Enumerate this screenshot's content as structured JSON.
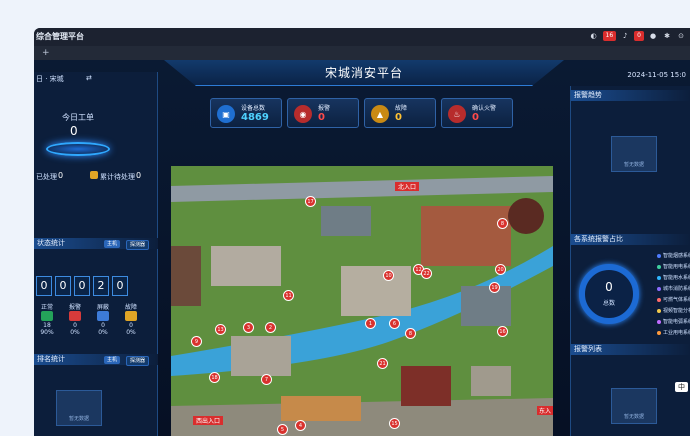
{
  "window": {
    "title": "综合管理平台",
    "alerts_count": "16",
    "notify_count": "0"
  },
  "app": {
    "title": "宋城消安平台",
    "datetime": "2024-11-05 15:0",
    "left": {
      "scope_label": "日 · 宋城",
      "swap_icon": "⇄",
      "today_title": "今日工单",
      "today_value": "0",
      "processed_label": "已处理",
      "processed_value": "0",
      "pending_label": "累计待处理",
      "pending_value": "0",
      "device_stats_title": "状态统计",
      "tab_host": "主机",
      "tab_detector": "探测器",
      "digits": [
        "0",
        "0",
        "0",
        "2",
        "0"
      ],
      "stats": [
        {
          "label": "正常",
          "value": "18",
          "pct": "90%",
          "color": "#24a35a"
        },
        {
          "label": "报警",
          "value": "0",
          "pct": "0%",
          "color": "#d63b3b"
        },
        {
          "label": "屏蔽",
          "value": "0",
          "pct": "0%",
          "color": "#3d7bd8"
        },
        {
          "label": "故障",
          "value": "0",
          "pct": "0%",
          "color": "#e0a526"
        }
      ],
      "rank_title": "排名统计",
      "rank_tab_host": "主机",
      "rank_tab_detector": "探测器",
      "no_data": "暂无数据"
    },
    "kpis": [
      {
        "label": "设备总数",
        "value": "4869",
        "color": "#4fd2ff",
        "icon": "▣",
        "bg": "#1f6fd1"
      },
      {
        "label": "报警",
        "value": "0",
        "color": "#ff4a4a",
        "icon": "◉",
        "bg": "#b72c2c"
      },
      {
        "label": "故障",
        "value": "0",
        "color": "#ffc233",
        "icon": "▲",
        "bg": "#c98a14"
      },
      {
        "label": "确认火警",
        "value": "0",
        "color": "#ff4a4a",
        "icon": "♨",
        "bg": "#b72c2c"
      }
    ],
    "map": {
      "north_entrance": "北入口",
      "west_entrance": "西出入口",
      "east_entrance": "东入",
      "pins": [
        "17",
        "12",
        "11",
        "2",
        "3",
        "1",
        "18",
        "7",
        "13",
        "16",
        "19",
        "20",
        "8",
        "6",
        "8",
        "21",
        "10",
        "5",
        "4",
        "22",
        "9",
        "15"
      ]
    },
    "right": {
      "alarm_trend_title": "报警趋势",
      "no_data": "暂无数据",
      "alarm_share_title": "各系统报警占比",
      "donut_value": "0",
      "donut_label": "总数",
      "legend": [
        {
          "label": "智能烟感系统",
          "color": "#4f7cff"
        },
        {
          "label": "智能用电系统",
          "color": "#3fd0a0"
        },
        {
          "label": "智能用水系统",
          "color": "#2fb6ff"
        },
        {
          "label": "城市消防系统",
          "color": "#8b6cff"
        },
        {
          "label": "可燃气体系统",
          "color": "#ff6b6b"
        },
        {
          "label": "视频智能分析",
          "color": "#f2c94c"
        },
        {
          "label": "智能电弧系统",
          "color": "#c06cff"
        },
        {
          "label": "工业用电系统",
          "color": "#ff9a3c"
        }
      ],
      "alarm_list_title": "报警列表",
      "ime": "中"
    }
  }
}
